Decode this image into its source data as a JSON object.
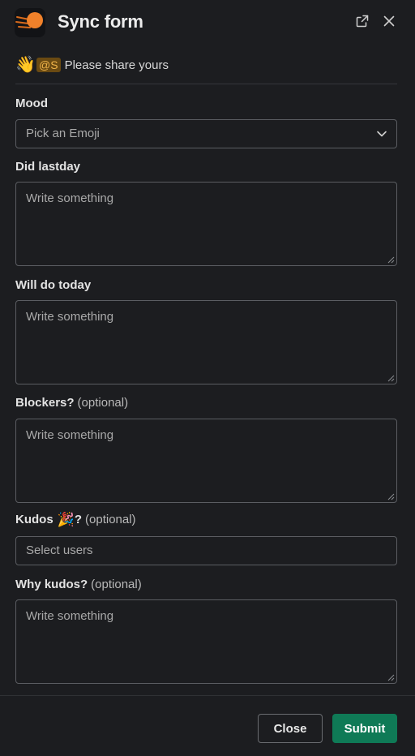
{
  "header": {
    "title": "Sync form",
    "logo_icon": "comet-logo-icon",
    "popout_icon": "external-link-icon",
    "close_icon": "close-icon"
  },
  "intro": {
    "emoji": "👋",
    "mention": "@S",
    "text": "Please share yours"
  },
  "fields": {
    "mood": {
      "label": "Mood",
      "placeholder": "Pick an Emoji"
    },
    "did_lastday": {
      "label": "Did lastday",
      "placeholder": "Write something"
    },
    "will_do_today": {
      "label": "Will do today",
      "placeholder": "Write something"
    },
    "blockers": {
      "label": "Blockers?",
      "optional": "(optional)",
      "placeholder": "Write something"
    },
    "kudos": {
      "label": "Kudos",
      "emoji": "🎉",
      "suffix": "?",
      "optional": "(optional)",
      "placeholder": "Select users"
    },
    "why_kudos": {
      "label": "Why kudos?",
      "optional": "(optional)",
      "placeholder": "Write something"
    }
  },
  "footer": {
    "close_label": "Close",
    "submit_label": "Submit"
  },
  "colors": {
    "background": "#1c1d20",
    "submit": "#0f7a56",
    "logo_accent": "#f0812a"
  }
}
